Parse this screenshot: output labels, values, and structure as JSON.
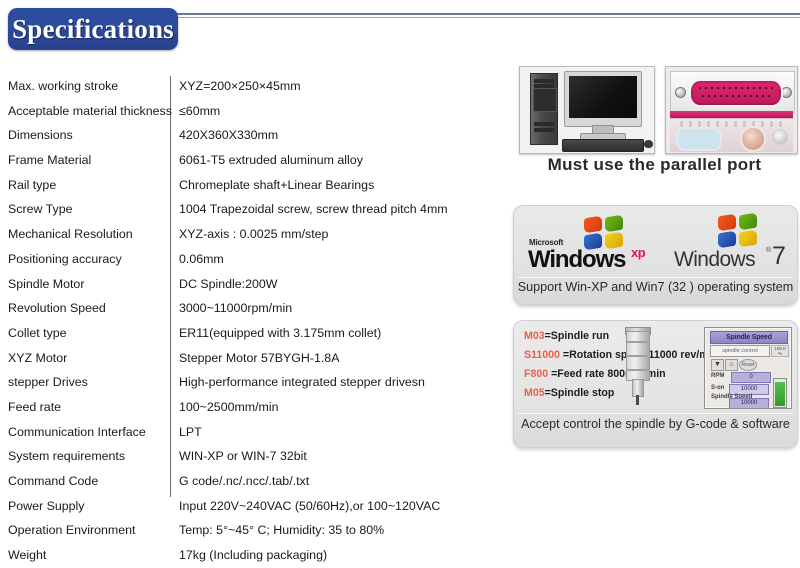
{
  "header": {
    "title": "Specifications"
  },
  "spec_table": {
    "rows": [
      {
        "label": "Max. working stroke",
        "value": "XYZ=200×250×45mm"
      },
      {
        "label": "Acceptable material thickness",
        "value": "≤60mm"
      },
      {
        "label": "Dimensions",
        "value": "420X360X330mm"
      },
      {
        "label": "Frame Material",
        "value": "6061-T5 extruded aluminum alloy"
      },
      {
        "label": "Rail type",
        "value": "Chromeplate shaft+Linear Bearings"
      },
      {
        "label": "Screw Type",
        "value": "1004 Trapezoidal screw, screw thread pitch 4mm"
      },
      {
        "label": "Mechanical Resolution",
        "value": "XYZ-axis : 0.0025 mm/step"
      },
      {
        "label": "Positioning accuracy",
        "value": "0.06mm"
      },
      {
        "label": "Spindle Motor",
        "value": "DC Spindle:200W"
      },
      {
        "label": "Revolution Speed",
        "value": "3000~11000rpm/min"
      },
      {
        "label": "Collet type",
        "value": " ER11(equipped with 3.175mm collet)"
      },
      {
        "label": "XYZ Motor",
        "value": "Stepper Motor 57BYGH-1.8A"
      },
      {
        "label": "stepper Drives",
        "value": "High-performance integrated stepper drivesn"
      },
      {
        "label": "Feed rate",
        "value": "100~2500mm/min"
      },
      {
        "label": "Communication Interface",
        "value": "LPT"
      },
      {
        "label": "System requirements",
        "value": " WIN-XP or WIN-7 32bit"
      },
      {
        "label": "Command Code",
        "value": "G code/.nc/.ncc/.tab/.txt"
      },
      {
        "label": "Power Supply",
        "value": " Input 220V~240VAC (50/60Hz),or 100~120VAC"
      },
      {
        "label": "Operation Environment",
        "value": "Temp: 5°~45° C;   Humidity: 35 to 80%"
      },
      {
        "label": "Weight",
        "value": "17kg (Including packaging)"
      }
    ]
  },
  "panels": {
    "parallel": {
      "caption": "Must use the parallel port",
      "pc_photo_name": "desktop-computer-photo",
      "port_photo_name": "parallel-port-photo"
    },
    "windows": {
      "caption": "Support Win-XP and Win7 (32 ) operating system",
      "xp": {
        "microsoft": "Microsoft",
        "word": "Windows",
        "sup": "xp"
      },
      "win7": {
        "word": "Windows",
        "reg": "®",
        "num": "7"
      }
    },
    "spindle": {
      "caption": "Accept control the spindle by G-code & software",
      "codes": [
        {
          "key": "M03",
          "eq": "=",
          "desc": "Spindle run",
          "extra": ""
        },
        {
          "key": "S11000",
          "eq": " =",
          "desc": "Rotation speed",
          "extra": "   11000 rev/min"
        },
        {
          "key": "F800",
          "eq": "    =",
          "desc": "Feed rate 800mm/min",
          "extra": ""
        },
        {
          "key": "M05",
          "eq": "=",
          "desc": "Spindle stop",
          "extra": ""
        }
      ],
      "ui": {
        "title": "Spindle Speed",
        "field": "spindle control",
        "pct": "100.0 %",
        "btn1": "▼",
        "btn2": "⌂",
        "btn3": "Reset",
        "rpm_label": "RPM",
        "rpm_value": "0",
        "son_label": "S-on",
        "son_value": "10000",
        "ss_label": "Spindle Speed",
        "ss_value": "10000"
      }
    }
  },
  "colors": {
    "title_blue": "#2c4da0",
    "code_red": "#e8604f",
    "port_magenta": "#e0266e",
    "panel_gray": "#e6e6e6"
  }
}
